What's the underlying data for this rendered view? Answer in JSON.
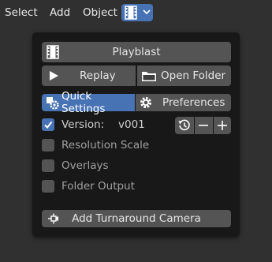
{
  "menubar": {
    "items": [
      "Select",
      "Add",
      "Object"
    ],
    "dropdown_icon": "film-strip-icon"
  },
  "panel": {
    "playblast_label": "Playblast",
    "replay_label": "Replay",
    "open_folder_label": "Open Folder",
    "tabs": [
      {
        "label": "Quick Settings",
        "icon": "settings-gear-icon",
        "active": true
      },
      {
        "label": "Preferences",
        "icon": "gear-icon",
        "active": false
      }
    ],
    "version": {
      "label": "Version:",
      "value": "v001",
      "checked": true
    },
    "options": [
      {
        "label": "Resolution Scale",
        "checked": false
      },
      {
        "label": "Overlays",
        "checked": false
      },
      {
        "label": "Folder Output",
        "checked": false
      }
    ],
    "turnaround_label": "Add Turnaround Camera"
  },
  "colors": {
    "accent": "#4772b3",
    "button": "#545454",
    "panel_bg": "#181818",
    "app_bg": "#303030"
  }
}
